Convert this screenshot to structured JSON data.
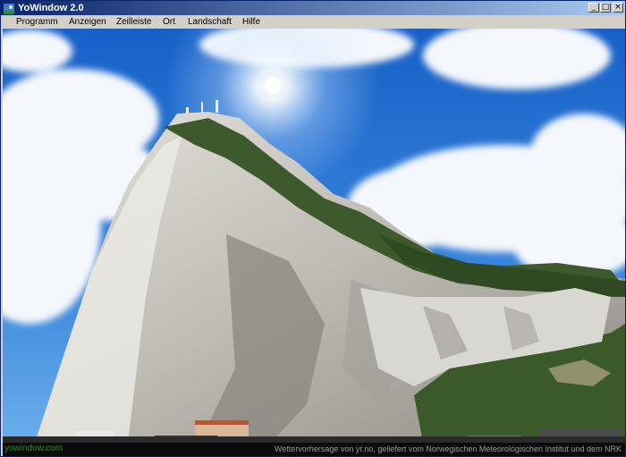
{
  "window": {
    "title": "YoWindow 2.0",
    "minimize_glyph": "_",
    "maximize_glyph": "□",
    "close_glyph": "×"
  },
  "menu": {
    "items": [
      {
        "label": "Programm"
      },
      {
        "label": "Anzeigen"
      },
      {
        "label": "Zeilleiste"
      },
      {
        "label": "Ort"
      },
      {
        "label": "Landschaft"
      },
      {
        "label": "Hilfe"
      }
    ]
  },
  "status": {
    "brand": "yowindow.com",
    "credit": "Wettervorhersage von yr.no, geliefert vom Norwegischen Meteorologischen Institut und dem NRK"
  },
  "colors": {
    "sky_top": "#1660c8",
    "sky_bottom": "#5aa2e8",
    "rock": "#c8c6c0",
    "vegetation": "#3c5a2c",
    "brand_green": "#2e8b2e"
  },
  "icons": {
    "app": "yowindow-app-icon",
    "minimize": "minimize-icon",
    "maximize": "maximize-icon",
    "close": "close-icon"
  }
}
